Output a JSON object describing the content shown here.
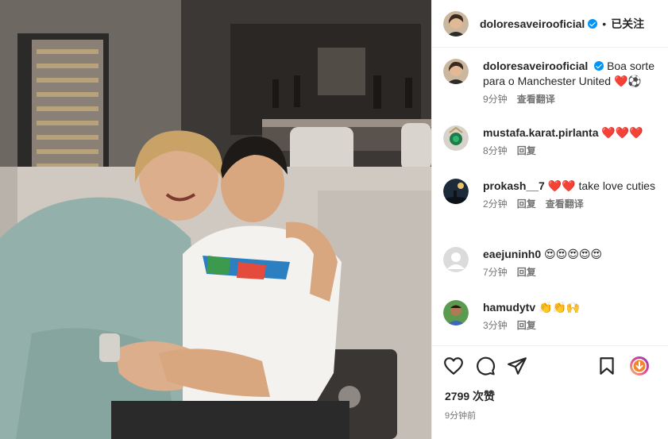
{
  "post": {
    "username": "doloresaveirooficial",
    "dot": "•",
    "follow_status": "已关注"
  },
  "caption": {
    "username": "doloresaveirooficial",
    "text": "Boa sorte para o Manchester United ❤️⚽",
    "time": "9分钟",
    "translate": "查看翻译"
  },
  "comments": [
    {
      "username": "mustafa.karat.pirlanta",
      "text": "❤️❤️❤️",
      "time": "8分钟",
      "reply": "回复"
    },
    {
      "username": "prokash__7",
      "text": "❤️❤️ take love cuties",
      "time": "2分钟",
      "reply": "回复",
      "translate": "查看翻译"
    },
    {
      "username": "eaejuninh0",
      "text": "😍😍😍😍😍",
      "time": "7分钟",
      "reply": "回复"
    },
    {
      "username": "hamudytv",
      "text": "👏👏🙌",
      "time": "3分钟",
      "reply": "回复"
    }
  ],
  "stats": {
    "likes": "2799 次赞",
    "posted": "9分钟前"
  },
  "icons": {
    "like": "heart-outline-icon",
    "comment": "comment-bubble-icon",
    "share": "paper-plane-icon",
    "save": "bookmark-icon",
    "reel": "reel-badge-icon"
  },
  "colors": {
    "verified": "#0095f6",
    "heart": "#ed1c24",
    "muted": "#737373"
  }
}
